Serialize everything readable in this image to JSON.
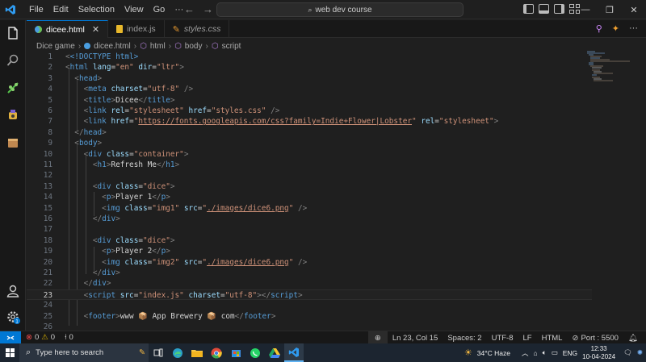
{
  "menu": [
    "File",
    "Edit",
    "Selection",
    "View",
    "Go",
    "···"
  ],
  "command_center": "web dev course",
  "tabs": [
    {
      "label": "dicee.html",
      "active": true,
      "icon": "html-icon"
    },
    {
      "label": "index.js",
      "active": false,
      "icon": "js-icon"
    },
    {
      "label": "styles.css",
      "active": false,
      "icon": "css-icon"
    }
  ],
  "breadcrumb": [
    "Dice game",
    "dicee.html",
    "html",
    "body",
    "script"
  ],
  "code_lines": [
    {
      "n": "1"
    },
    {
      "n": "2"
    },
    {
      "n": "3"
    },
    {
      "n": "4"
    },
    {
      "n": "5"
    },
    {
      "n": "6"
    },
    {
      "n": "7"
    },
    {
      "n": "8"
    },
    {
      "n": "9"
    },
    {
      "n": "10"
    },
    {
      "n": "11"
    },
    {
      "n": "12"
    },
    {
      "n": "13"
    },
    {
      "n": "14"
    },
    {
      "n": "15"
    },
    {
      "n": "16"
    },
    {
      "n": "17"
    },
    {
      "n": "18"
    },
    {
      "n": "19"
    },
    {
      "n": "20"
    },
    {
      "n": "21"
    },
    {
      "n": "22"
    },
    {
      "n": "23"
    },
    {
      "n": "24"
    },
    {
      "n": "25"
    },
    {
      "n": "26"
    }
  ],
  "code": {
    "l1": "<!DOCTYPE html>",
    "l2_tag": "html",
    "l2_attr1": "lang",
    "l2_val1": "\"en\"",
    "l2_attr2": "dir",
    "l2_val2": "\"ltr\"",
    "l3": "head",
    "l4_attr": "charset",
    "l4_val": "\"utf-8\"",
    "l5_text": "Dicee",
    "l6_val1": "\"stylesheet\"",
    "l6_val2": "\"styles.css\"",
    "l7_url": "https://fonts.googleapis.com/css?family=Indie+Flower|Lobster",
    "l7_rel": "\"stylesheet\"",
    "l10_val": "\"container\"",
    "l11_text": "Refresh Me",
    "l13_val": "\"dice\"",
    "l14_text": "Player 1",
    "l15_class": "\"img1\"",
    "l15_src": "./images/dice6.png",
    "l18_val": "\"dice\"",
    "l19_text": "Player 2",
    "l20_class": "\"img2\"",
    "l20_src": "./images/dice6.png",
    "l23_src": "\"index.js\"",
    "l23_charset": "\"utf-8\"",
    "l25_text": "www 📦 App Brewery 📦 com"
  },
  "status": {
    "errors": "0",
    "warnings": "0",
    "ports": "0",
    "position": "Ln 23, Col 15",
    "spaces": "Spaces: 2",
    "encoding": "UTF-8",
    "eol": "LF",
    "language": "HTML",
    "port": "Port : 5500"
  },
  "taskbar": {
    "search_placeholder": "Type here to search",
    "weather": "34°C  Haze",
    "lang": "ENG",
    "time": "12:33",
    "date": "10-04-2024"
  },
  "accent_color": "#0078d4"
}
